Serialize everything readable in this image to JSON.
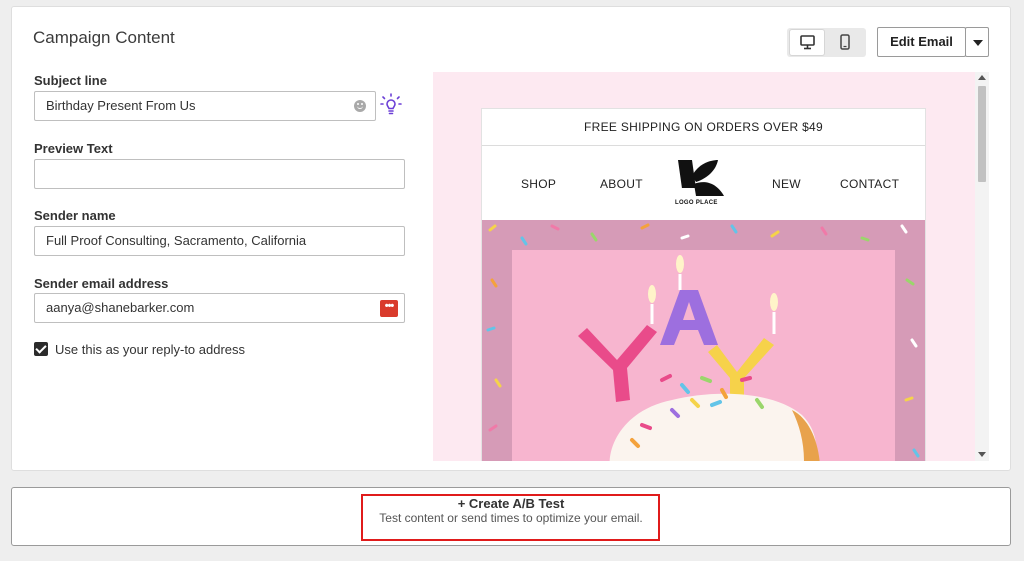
{
  "card": {
    "title": "Campaign Content"
  },
  "subject": {
    "label": "Subject line",
    "value": "Birthday Present From Us"
  },
  "preview_text": {
    "label": "Preview Text",
    "value": ""
  },
  "sender_name": {
    "label": "Sender name",
    "value": "Full Proof Consulting, Sacramento, California"
  },
  "sender_email": {
    "label": "Sender email address",
    "value": "aanya@shanebarker.com"
  },
  "reply_to": {
    "label": "Use this as your reply-to address",
    "checked": true
  },
  "toolbar": {
    "edit_email_label": "Edit Email",
    "desktop_icon": "desktop-icon",
    "mobile_icon": "mobile-icon"
  },
  "email_preview": {
    "shipping_banner": "FREE SHIPPING ON ORDERS OVER $49",
    "nav": [
      "SHOP",
      "ABOUT",
      "NEW",
      "CONTACT"
    ],
    "logo_text": "LOGO PLACE",
    "hero_image": "birthday-cupcake-yay-candles"
  },
  "ab_test": {
    "title": "+ Create A/B Test",
    "subtitle": "Test content or send times to optimize your email."
  },
  "colors": {
    "highlight": "#e01b1b",
    "preview_bg": "#fde9f1",
    "dots_badge": "#d93b2c",
    "bulb": "#6b3fd6"
  }
}
